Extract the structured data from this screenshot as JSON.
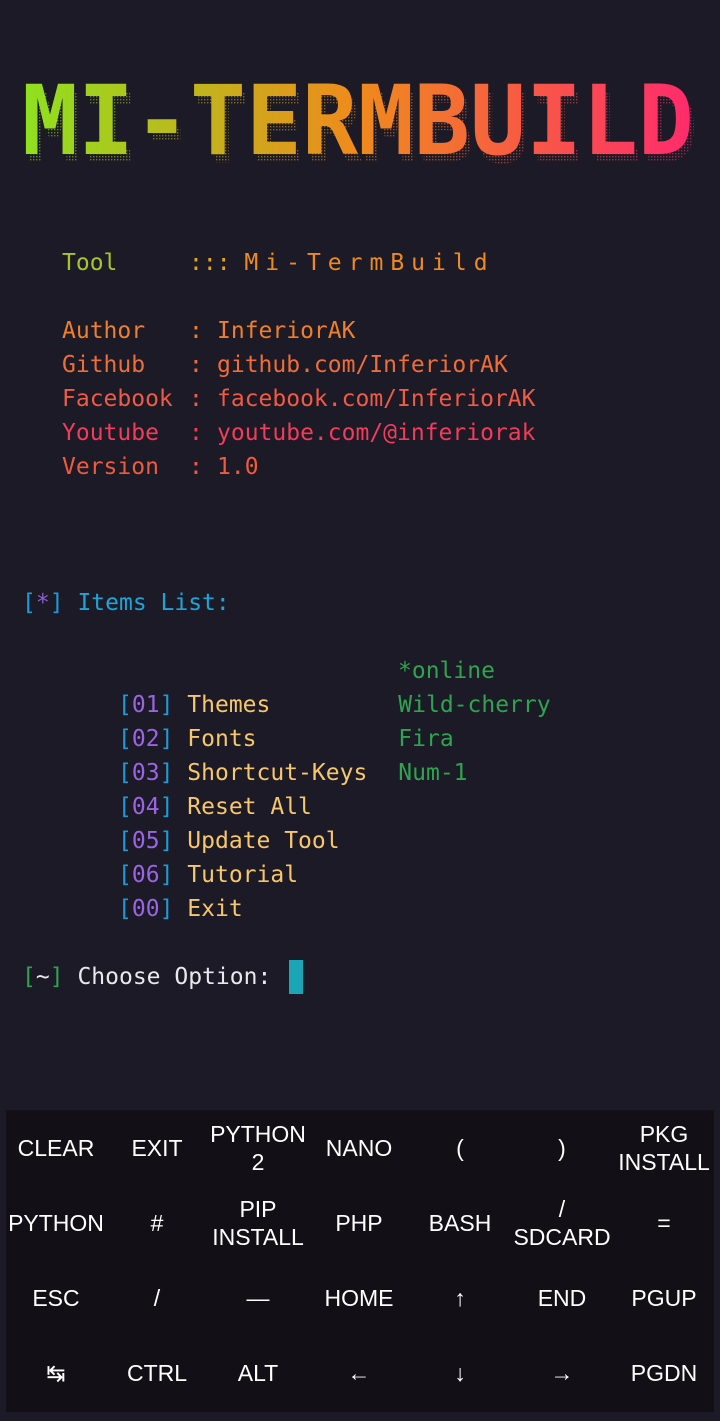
{
  "banner": {
    "text": "MI-TERMBUILD",
    "gradient_start": "#8ee21e",
    "gradient_mid": "#f08a1c",
    "gradient_end": "#ff2a6d"
  },
  "tool": {
    "label": "Tool",
    "separator": ":::",
    "name": "Mi-TermBuild"
  },
  "info": [
    {
      "key": "Author",
      "colon": ":",
      "value": "InferiorAK",
      "color": "#ef7f2c"
    },
    {
      "key": "Github",
      "colon": ":",
      "value": "github.com/InferiorAK",
      "color": "#ef6d36"
    },
    {
      "key": "Facebook",
      "colon": ":",
      "value": "facebook.com/InferiorAK",
      "color": "#f15a44"
    },
    {
      "key": "Youtube",
      "colon": ":",
      "value": "youtube.com/@inferiorak",
      "color": "#f23c59"
    },
    {
      "key": "Version",
      "colon": ":",
      "value": "1.0",
      "color": "#ef5b3c"
    }
  ],
  "items_header": {
    "open": "[",
    "star": "*",
    "close": "]",
    "title": "Items List:"
  },
  "online_label": "*online",
  "menu": [
    {
      "open": "[",
      "num": "01",
      "close": "]",
      "label": "Themes",
      "status": "Wild-cherry"
    },
    {
      "open": "[",
      "num": "02",
      "close": "]",
      "label": "Fonts",
      "status": "Fira"
    },
    {
      "open": "[",
      "num": "03",
      "close": "]",
      "label": "Shortcut-Keys",
      "status": "Num-1"
    },
    {
      "open": "[",
      "num": "04",
      "close": "]",
      "label": "Reset All",
      "status": ""
    },
    {
      "open": "[",
      "num": "05",
      "close": "]",
      "label": "Update Tool",
      "status": ""
    },
    {
      "open": "[",
      "num": "06",
      "close": "]",
      "label": "Tutorial",
      "status": ""
    },
    {
      "open": "[",
      "num": "00",
      "close": "]",
      "label": "Exit",
      "status": ""
    }
  ],
  "prompt": {
    "open": "[",
    "tilde": "~",
    "close": "]",
    "text": "Choose Option:"
  },
  "keyboard": {
    "rows": [
      [
        {
          "label": "CLEAR",
          "name": "key-clear"
        },
        {
          "label": "EXIT",
          "name": "key-exit"
        },
        {
          "label": "PYTHON\n2",
          "name": "key-python2"
        },
        {
          "label": "NANO",
          "name": "key-nano"
        },
        {
          "label": "(",
          "name": "key-open-paren"
        },
        {
          "label": ")",
          "name": "key-close-paren"
        },
        {
          "label": "PKG\nINSTALL",
          "name": "key-pkg-install"
        }
      ],
      [
        {
          "label": "PYTHON",
          "name": "key-python"
        },
        {
          "label": "#",
          "name": "key-hash"
        },
        {
          "label": "PIP\nINSTALL",
          "name": "key-pip-install"
        },
        {
          "label": "PHP",
          "name": "key-php"
        },
        {
          "label": "BASH",
          "name": "key-bash"
        },
        {
          "label": "/\nSDCARD",
          "name": "key-sdcard"
        },
        {
          "label": "=",
          "name": "key-equals"
        }
      ],
      [
        {
          "label": "ESC",
          "name": "key-esc"
        },
        {
          "label": "/",
          "name": "key-slash"
        },
        {
          "label": "—",
          "name": "key-dash"
        },
        {
          "label": "HOME",
          "name": "key-home"
        },
        {
          "label": "↑",
          "name": "key-arrow-up"
        },
        {
          "label": "END",
          "name": "key-end"
        },
        {
          "label": "PGUP",
          "name": "key-pgup"
        }
      ],
      [
        {
          "label": "↹",
          "name": "key-tab"
        },
        {
          "label": "CTRL",
          "name": "key-ctrl"
        },
        {
          "label": "ALT",
          "name": "key-alt"
        },
        {
          "label": "←",
          "name": "key-arrow-left"
        },
        {
          "label": "↓",
          "name": "key-arrow-down"
        },
        {
          "label": "→",
          "name": "key-arrow-right"
        },
        {
          "label": "PGDN",
          "name": "key-pgdn"
        }
      ]
    ]
  }
}
